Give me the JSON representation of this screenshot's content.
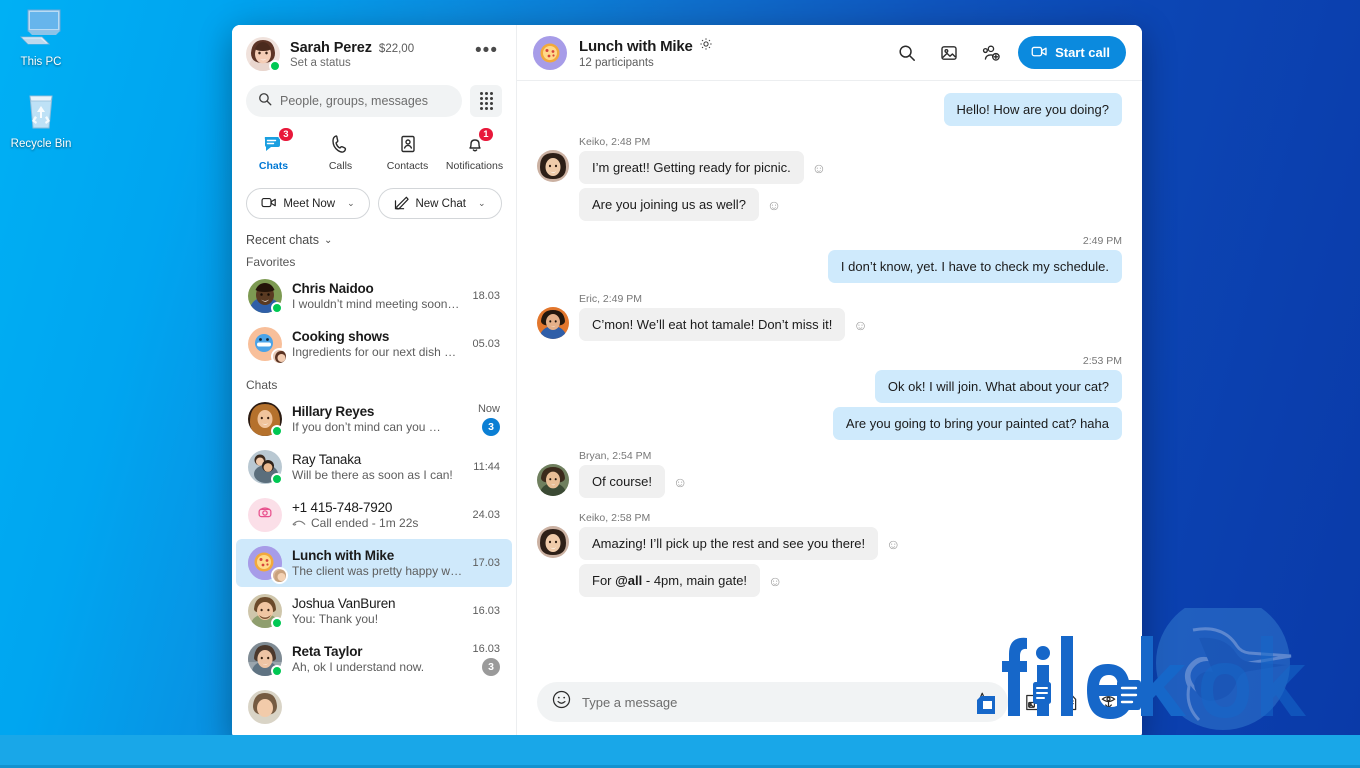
{
  "desktop": {
    "icons": [
      {
        "label": "This PC",
        "icon": "computer-icon"
      },
      {
        "label": "Recycle Bin",
        "icon": "recycle-bin-icon"
      }
    ]
  },
  "sidebar": {
    "profile": {
      "name": "Sarah Perez",
      "credit": "$22,00",
      "status": "Set a status",
      "more_label": "•••",
      "presence": "online"
    },
    "search": {
      "placeholder": "People, groups, messages",
      "value": "",
      "icon": "search-icon",
      "dialpad_icon": "dialpad-icon"
    },
    "tabs": [
      {
        "label": "Chats",
        "icon": "chat-icon",
        "badge": "3",
        "active": true
      },
      {
        "label": "Calls",
        "icon": "phone-icon",
        "badge": "",
        "active": false
      },
      {
        "label": "Contacts",
        "icon": "contact-card-icon",
        "badge": "",
        "active": false
      },
      {
        "label": "Notifications",
        "icon": "bell-icon",
        "badge": "1",
        "active": false
      }
    ],
    "actions": [
      {
        "label": "Meet Now",
        "icon": "video-camera-icon",
        "caret": "⌄"
      },
      {
        "label": "New Chat",
        "icon": "compose-icon",
        "caret": "⌄"
      }
    ],
    "recent_chats_label": "Recent chats",
    "recent_chats_caret": "⌄",
    "groups": [
      {
        "heading": "Favorites"
      },
      {
        "heading": "Chats"
      }
    ],
    "favorites": [
      {
        "name": "Chris Naidoo",
        "preview": "I wouldn’t mind meeting sooner…",
        "time": "18.03",
        "presence": "online",
        "unread": "",
        "bold": true,
        "avatar_color": "#6d8a4e"
      },
      {
        "name": "Cooking shows",
        "preview": "Ingredients for our next dish are…",
        "time": "05.03",
        "presence": "none",
        "unread": "",
        "bold": true,
        "avatar_color": "#f5b68f"
      }
    ],
    "chats": [
      {
        "name": "Hillary Reyes",
        "preview": "If you don’t mind can you finish…",
        "time": "Now",
        "presence": "online",
        "unread": "3",
        "unread_muted": false,
        "bold": true,
        "avatar_color": "#8d5524"
      },
      {
        "name": "Ray Tanaka",
        "preview": "Will be there as soon as I can!",
        "time": "11:44",
        "presence": "online",
        "unread": "",
        "unread_muted": false,
        "bold": false,
        "avatar_color": "#b7c6cf"
      },
      {
        "name": "+1 415-748-7920",
        "preview": "Call ended - 1m 22s",
        "preview_icon": "call-ended-icon",
        "time": "24.03",
        "presence": "none",
        "unread": "",
        "unread_muted": false,
        "bold": false,
        "avatar_color": "#fbdfe8",
        "avatar_type": "phone"
      },
      {
        "name": "Lunch with Mike",
        "preview": "The client was pretty happy with…",
        "time": "17.03",
        "presence": "none",
        "unread": "",
        "unread_muted": false,
        "bold": true,
        "selected": true,
        "avatar_color": "#a79ce8",
        "avatar_type": "pizza"
      },
      {
        "name": "Joshua VanBuren",
        "preview": "You: Thank you!",
        "time": "16.03",
        "presence": "online",
        "unread": "",
        "unread_muted": false,
        "bold": false,
        "avatar_color": "#c8bfa6"
      },
      {
        "name": "Reta Taylor",
        "preview": "Ah, ok I understand now.",
        "time": "16.03",
        "presence": "online",
        "unread": "3",
        "unread_muted": true,
        "bold": true,
        "avatar_color": "#8f9aa3"
      }
    ]
  },
  "conversation": {
    "header": {
      "title": "Lunch with Mike",
      "settings_icon": "gear-icon",
      "subtitle": "12 participants",
      "avatar_icon": "pizza-icon",
      "icons": [
        {
          "name": "search-icon"
        },
        {
          "name": "gallery-icon"
        },
        {
          "name": "add-people-icon"
        }
      ],
      "start_call_label": "Start call",
      "start_call_icon": "video-camera-icon",
      "accent_color": "#0b8ade"
    },
    "messages": [
      {
        "direction": "out",
        "text": "Hello! How are you doing?",
        "time": ""
      },
      {
        "direction": "in",
        "sender": "Keiko",
        "sender_line": "Keiko, 2:48 PM",
        "avatar_color": "#caa492",
        "bubbles": [
          {
            "text": "I’m great!! Getting ready for picnic.",
            "react": "☺"
          },
          {
            "text": "Are you joining us as well?",
            "react": "☺"
          }
        ]
      },
      {
        "direction": "out",
        "time": "2:49 PM",
        "text": "I don’t know, yet. I have to check my schedule."
      },
      {
        "direction": "in",
        "sender": "Eric",
        "sender_line": "Eric, 2:49 PM",
        "avatar_color": "#e2762c",
        "bubbles": [
          {
            "text": "C’mon! We’ll eat hot tamale! Don’t miss it!",
            "react": "☺"
          }
        ]
      },
      {
        "direction": "out",
        "time": "2:53 PM",
        "text": "Ok ok! I will join. What about your cat?"
      },
      {
        "direction": "out",
        "text": "Are you going to bring your painted cat? haha"
      },
      {
        "direction": "in",
        "sender": "Bryan",
        "sender_line": "Bryan, 2:54 PM",
        "avatar_color": "#6f7f5e",
        "bubbles": [
          {
            "text": "Of course!",
            "react": "☺"
          }
        ]
      },
      {
        "direction": "in",
        "sender": "Keiko",
        "sender_line": "Keiko, 2:58 PM",
        "avatar_color": "#caa492",
        "bubbles": [
          {
            "text": "Amazing! I’ll pick up the rest and see you there!",
            "react": "☺"
          },
          {
            "text": "For @all - 4pm, main gate!",
            "mention": "@all",
            "react": "☺"
          }
        ]
      }
    ],
    "composer": {
      "placeholder": "Type a message",
      "value": "",
      "emoji_icon": "emoji-icon",
      "markup_icon": "text-format-icon",
      "icons": [
        {
          "name": "image-attachment-icon"
        },
        {
          "name": "file-attachment-icon"
        },
        {
          "name": "more-options-icon"
        }
      ]
    }
  },
  "watermark": {
    "text": "filekoka",
    "logo": "stork-logo-icon",
    "color": "#1667c9"
  }
}
